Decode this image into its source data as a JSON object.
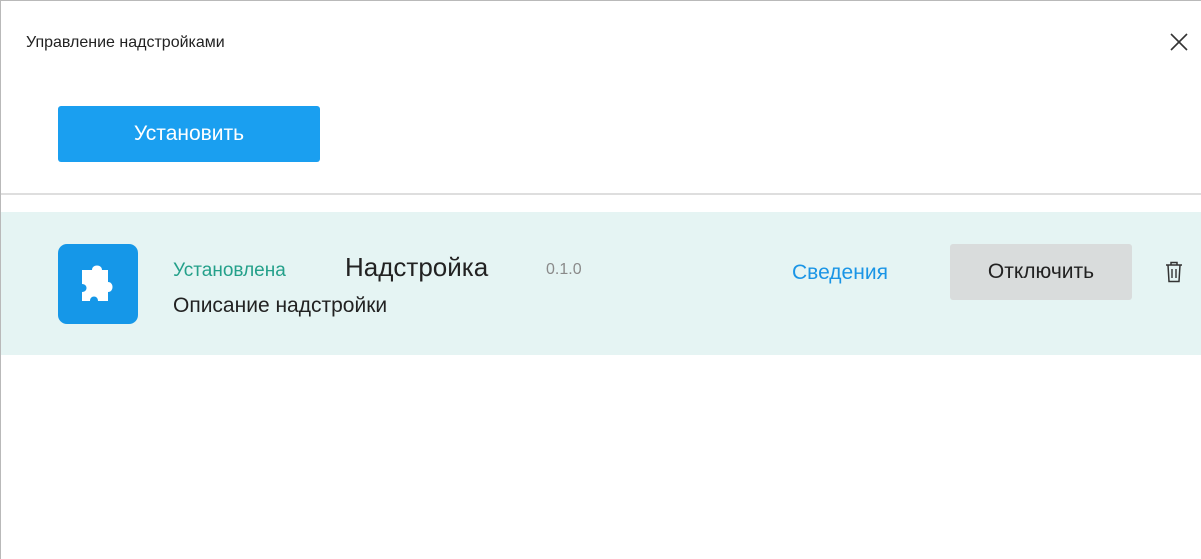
{
  "dialog": {
    "title": "Управление надстройками",
    "close_icon": "close-icon"
  },
  "toolbar": {
    "install_label": "Установить"
  },
  "addins": [
    {
      "status": "Установлена",
      "name": "Надстройка",
      "version": "0.1.0",
      "description": "Описание надстройки",
      "details_label": "Сведения",
      "disable_label": "Отключить",
      "icon": "puzzle-icon",
      "delete_icon": "trash-icon"
    }
  ],
  "colors": {
    "accent": "#1a9ff0",
    "status_installed": "#24a08a",
    "row_background": "#e5f4f3",
    "link": "#1a95e6",
    "secondary_button": "#d9dcdc"
  }
}
